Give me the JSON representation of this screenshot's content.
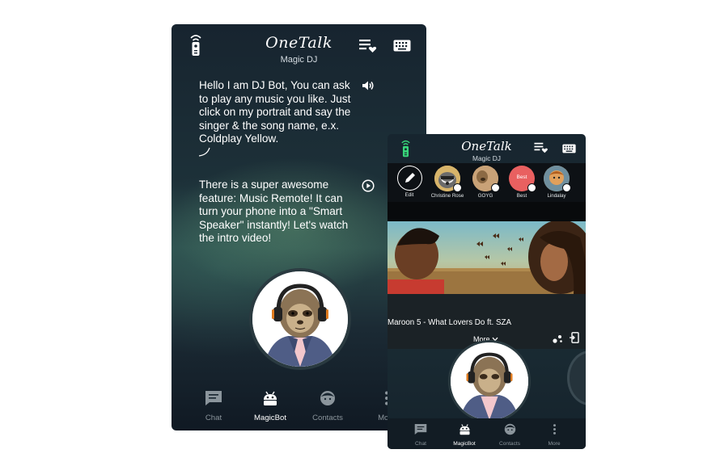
{
  "phone_main": {
    "brand": "OneTalk",
    "subtitle": "Magic DJ",
    "messages": [
      "Hello I am DJ Bot, You can ask to play any music you like. Just click on my portrait and say the singer & the song name, e.x. Coldplay Yellow.",
      "There is a super awesome feature: Music Remote! It can turn your phone into a \"Smart Speaker\" instantly! Let's watch the intro video!"
    ],
    "nav": [
      {
        "label": "Chat",
        "icon": "chat-icon"
      },
      {
        "label": "MagicBot",
        "icon": "robot-icon",
        "active": true
      },
      {
        "label": "Contacts",
        "icon": "contacts-face-icon"
      },
      {
        "label": "More",
        "icon": "more-vertical-icon"
      }
    ]
  },
  "phone_overlay": {
    "brand": "OneTalk",
    "subtitle": "Magic DJ",
    "contacts": [
      {
        "name": "Edit",
        "icon": "pencil-icon"
      },
      {
        "name": "Christine Rose"
      },
      {
        "name": "GOYG"
      },
      {
        "name": "Best",
        "badge_text": "Best"
      },
      {
        "name": "Lindalay"
      }
    ],
    "video_title": "Maroon 5 - What Lovers Do ft. SZA",
    "more_label": "More",
    "nav": [
      {
        "label": "Chat",
        "icon": "chat-icon"
      },
      {
        "label": "MagicBot",
        "icon": "robot-icon",
        "active": true
      },
      {
        "label": "Contacts",
        "icon": "contacts-face-icon"
      },
      {
        "label": "More",
        "icon": "more-vertical-icon"
      }
    ]
  },
  "colors": {
    "accent_green": "#38d67a",
    "best_badge": "#e96060",
    "text_muted": "#8b959c"
  }
}
